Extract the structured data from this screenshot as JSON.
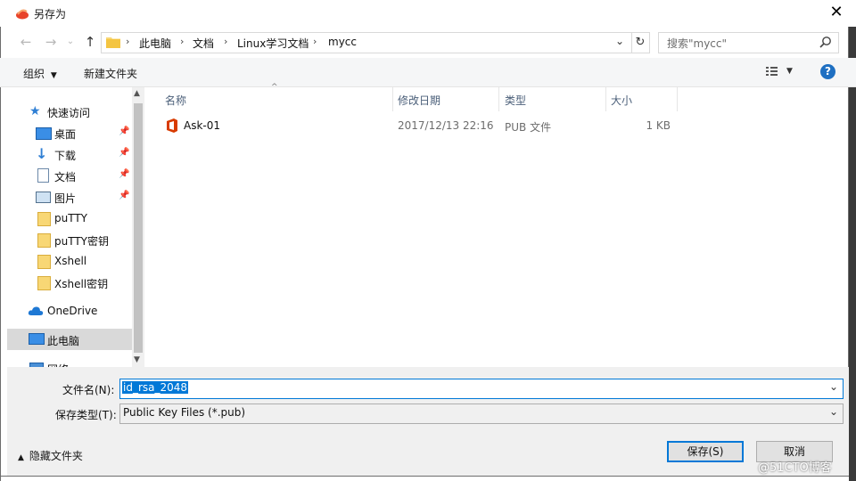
{
  "window": {
    "title": "另存为"
  },
  "nav": {
    "breadcrumb": [
      "此电脑",
      "文档",
      "Linux学习文档",
      "mycc"
    ],
    "search_placeholder": "搜索\"mycc\""
  },
  "toolbar": {
    "organize": "组织",
    "new_folder": "新建文件夹"
  },
  "sidebar": {
    "items": [
      {
        "label": "快速访问",
        "icon": "star-icon"
      },
      {
        "label": "桌面",
        "icon": "desktop-icon",
        "pinned": true
      },
      {
        "label": "下载",
        "icon": "download-icon",
        "pinned": true
      },
      {
        "label": "文档",
        "icon": "document-icon",
        "pinned": true
      },
      {
        "label": "图片",
        "icon": "picture-icon",
        "pinned": true
      },
      {
        "label": "puTTY",
        "icon": "folder-icon"
      },
      {
        "label": "puTTY密钥",
        "icon": "folder-icon"
      },
      {
        "label": "Xshell",
        "icon": "folder-icon"
      },
      {
        "label": "Xshell密钥",
        "icon": "folder-icon"
      },
      {
        "label": "OneDrive",
        "icon": "cloud-icon"
      },
      {
        "label": "此电脑",
        "icon": "computer-icon",
        "selected": true
      },
      {
        "label": "网络",
        "icon": "network-icon"
      }
    ]
  },
  "filelist": {
    "columns": [
      "名称",
      "修改日期",
      "类型",
      "大小"
    ],
    "rows": [
      {
        "name": "Ask-01",
        "date": "2017/12/13 22:16",
        "type": "PUB 文件",
        "size": "1 KB"
      }
    ]
  },
  "form": {
    "filename_label": "文件名(N):",
    "filename_value": "id_rsa_2048",
    "filetype_label": "保存类型(T):",
    "filetype_value": "Public Key Files (*.pub)"
  },
  "footer": {
    "hide_folders": "隐藏文件夹",
    "save": "保存(S)",
    "cancel": "取消"
  },
  "watermark": "@51CTO博客",
  "colors": {
    "accent": "#0078d7",
    "selection": "#cce8ff",
    "office_red": "#d83b01"
  }
}
